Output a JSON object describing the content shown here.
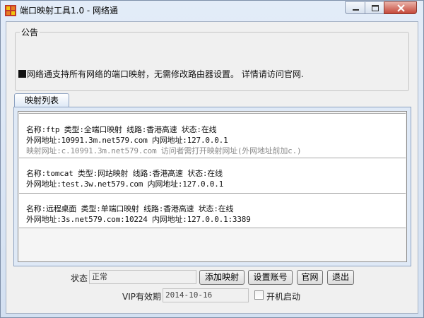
{
  "window": {
    "title": "端口映射工具1.0 - 网络通"
  },
  "notice": {
    "legend": "公告",
    "text": "网络通支持所有网络的端口映射，无需修改路由器设置。 详情请访问官网."
  },
  "tabs": [
    {
      "label": "映射列表"
    }
  ],
  "mappings": [
    {
      "line1": "名称:ftp  类型:全端口映射  线路:香港高速  状态:在线",
      "line2": "外网地址:10991.3m.net579.com  内网地址:127.0.0.1",
      "line3": "映射网址:c.10991.3m.net579.com  访问者需打开映射网址(外网地址前加c.)"
    },
    {
      "line1": "名称:tomcat  类型:网站映射  线路:香港高速  状态:在线",
      "line2": "外网地址:test.3w.net579.com  内网地址:127.0.0.1"
    },
    {
      "line1": "名称:远程桌面  类型:单端口映射  线路:香港高速  状态:在线",
      "line2": "外网地址:3s.net579.com:10224  内网地址:127.0.0.1:3389"
    }
  ],
  "status": {
    "label": "状态",
    "value": "正常"
  },
  "buttons": {
    "add_mapping": "添加映射",
    "account_settings": "设置账号",
    "official_site": "官网",
    "exit": "退出"
  },
  "vip": {
    "label": "VIP有效期",
    "value": "2014-10-16"
  },
  "autostart": {
    "label": "开机启动",
    "checked": false
  }
}
